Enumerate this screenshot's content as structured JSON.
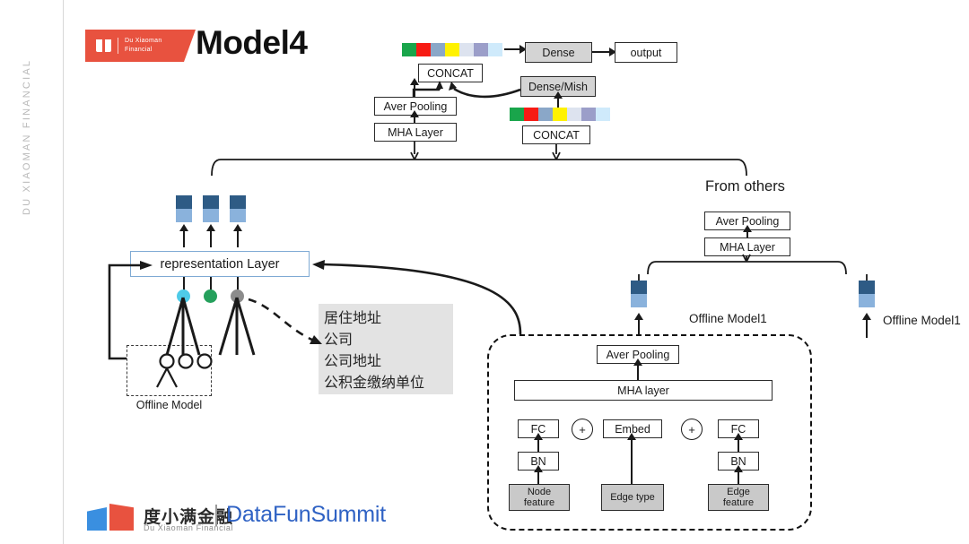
{
  "page": {
    "title": "Model4",
    "side_text": "DU XIAOMAN FINANCIAL"
  },
  "header_logo": {
    "line1": "Du Xiaoman",
    "line2": "Financial",
    "icon": "book-icon",
    "color": "#e8523f"
  },
  "footer": {
    "cn_name": "度小满金融",
    "en_name": "Du Xiaoman Financial",
    "divider": "|",
    "brand": "DataFunSummit",
    "brand_color": "#2f62c4"
  },
  "top_flow": {
    "output": "output",
    "dense": "Dense",
    "concat_top": "CONCAT",
    "dense_mish": "Dense/Mish",
    "concat_right": "CONCAT",
    "aver_pooling": "Aver Pooling",
    "mha_layer": "MHA Layer"
  },
  "ribbon_colors": [
    "#19a54b",
    "#f71b14",
    "#8aa7c8",
    "#fff200",
    "#dde3ef",
    "#9b9ec9",
    "#cfeafb"
  ],
  "representation": {
    "label": "representation Layer",
    "dots": [
      {
        "name": "dot-cyan",
        "color": "#4ecbe8"
      },
      {
        "name": "dot-green",
        "color": "#25a05c"
      },
      {
        "name": "dot-gray",
        "color": "#8c8c8c"
      }
    ],
    "token_colors": {
      "top": "#2e5b85",
      "bottom": "#8ab2dc"
    }
  },
  "offline_model": {
    "label": "Offline Model"
  },
  "feature_panel": {
    "lines": [
      "居住地址",
      "公司",
      "公司地址",
      "公积金缴纳单位"
    ],
    "background": "#e3e3e3"
  },
  "right_branch": {
    "from_others": "From others",
    "aver_pooling": "Aver Pooling",
    "mha_layer": "MHA Layer",
    "offline_model_left": "Offline Model1",
    "offline_model_right": "Offline Model1"
  },
  "gnn_module": {
    "aver_pooling": "Aver Pooling",
    "mha_layer": "MHA layer",
    "plus_left": "+",
    "plus_right": "+",
    "fc_left": "FC",
    "bn_left": "BN",
    "node_feature_l1": "Node",
    "node_feature_l2": "feature",
    "embed": "Embed",
    "edge_type": "Edge type",
    "fc_right": "FC",
    "bn_right": "BN",
    "edge_feature_l1": "Edge",
    "edge_feature_l2": "feature"
  }
}
